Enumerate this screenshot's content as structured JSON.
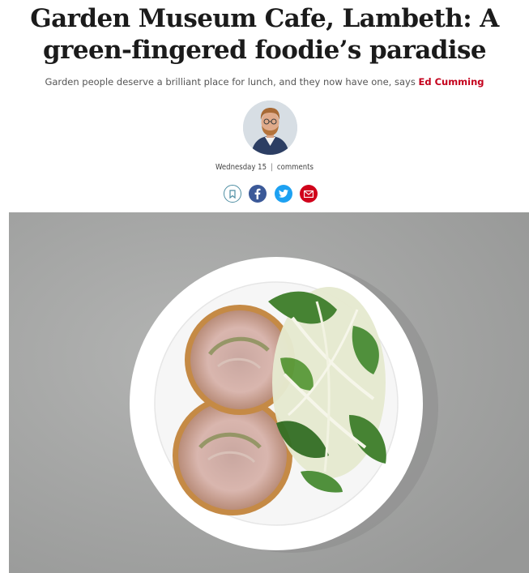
{
  "article": {
    "headline_line1": "Garden Museum Cafe, Lambeth: A",
    "headline_line2": "green-fingered foodie’s paradise",
    "standfirst_text": "Garden people deserve a brilliant place for lunch, and they now have one, says",
    "author_name": "Ed Cumming",
    "date": "Wednesday 15",
    "comments_label": "comments"
  },
  "share": {
    "icons": [
      "bookmark-icon",
      "facebook-icon",
      "twitter-icon",
      "email-icon"
    ],
    "colors": {
      "bookmark": "#4e8ea3",
      "facebook": "#3b5998",
      "twitter": "#1da1f2",
      "email": "#d0021b"
    }
  },
  "colors": {
    "author_accent": "#c4001c"
  }
}
